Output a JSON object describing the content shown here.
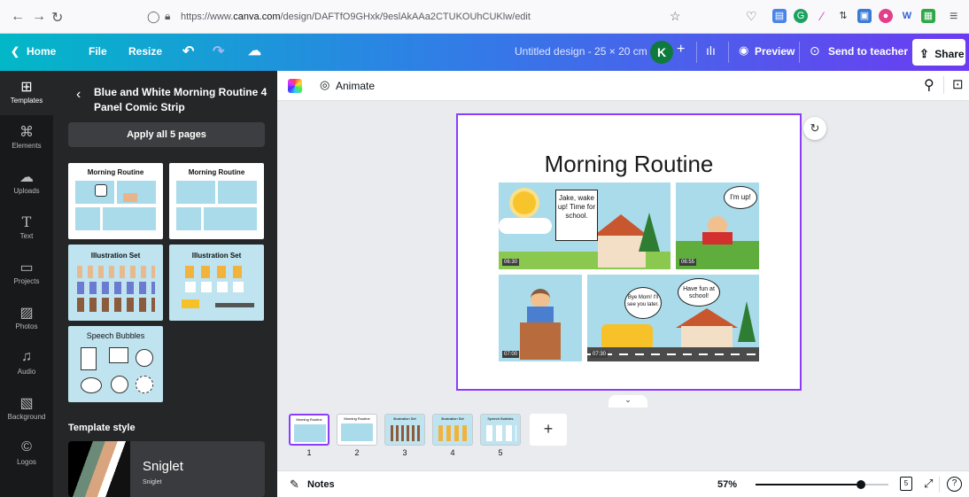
{
  "browser": {
    "url_prefix": "https://www.",
    "url_domain": "canva.com",
    "url_path": "/design/DAFTfO9GHxk/9eslAkAAa2CTUKOUhCUKlw/edit"
  },
  "topbar": {
    "home_label": "Home",
    "file_label": "File",
    "resize_label": "Resize",
    "doc_title": "Untitled design - 25 × 20 cm",
    "avatar_letter": "K",
    "preview_label": "Preview",
    "send_label": "Send to teacher",
    "share_label": "Share"
  },
  "rail": {
    "items": [
      {
        "label": "Templates",
        "icon": "templates-icon"
      },
      {
        "label": "Elements",
        "icon": "elements-icon"
      },
      {
        "label": "Uploads",
        "icon": "uploads-icon"
      },
      {
        "label": "Text",
        "icon": "text-icon"
      },
      {
        "label": "Projects",
        "icon": "projects-icon"
      },
      {
        "label": "Photos",
        "icon": "photos-icon"
      },
      {
        "label": "Audio",
        "icon": "audio-icon"
      },
      {
        "label": "Background",
        "icon": "background-icon"
      },
      {
        "label": "Logos",
        "icon": "logos-icon"
      }
    ]
  },
  "panel": {
    "title": "Blue and White Morning Routine 4 Panel Comic Strip",
    "apply_label": "Apply all 5 pages",
    "thumbs": [
      {
        "caption": "Morning Routine"
      },
      {
        "caption": "Morning Routine"
      },
      {
        "caption": "Illustration Set"
      },
      {
        "caption": "Illustration Set"
      },
      {
        "caption": "Speech Bubbles"
      }
    ],
    "template_style_label": "Template style",
    "style_name": "Sniglet",
    "style_sub": "Sniglet"
  },
  "editor": {
    "animate_label": "Animate",
    "design_title": "Morning Routine",
    "bubbles": {
      "b1": "Jake, wake up! Time for school.",
      "b2": "I'm up!",
      "b3": "Bye Mom! I'll see you later.",
      "b4": "Have fun at school!"
    },
    "times": [
      "06:30",
      "06:55",
      "07:00",
      "07:30"
    ]
  },
  "strip": {
    "thumbs": [
      {
        "num": "1",
        "caption": "Morning Routine"
      },
      {
        "num": "2",
        "caption": "Morning Routine"
      },
      {
        "num": "3",
        "caption": "Illustration Set"
      },
      {
        "num": "4",
        "caption": "Illustration Set"
      },
      {
        "num": "5",
        "caption": "Speech Bubbles"
      }
    ],
    "add_label": "+"
  },
  "bottombar": {
    "notes_label": "Notes",
    "zoom_value": "57%",
    "zoom_level": 0.57,
    "page_count": "5",
    "help_label": "?"
  },
  "colors": {
    "accent": "#8b3dff",
    "sidebar": "#18191b",
    "panel": "#252627",
    "comic_sky": "#a9dbea"
  }
}
